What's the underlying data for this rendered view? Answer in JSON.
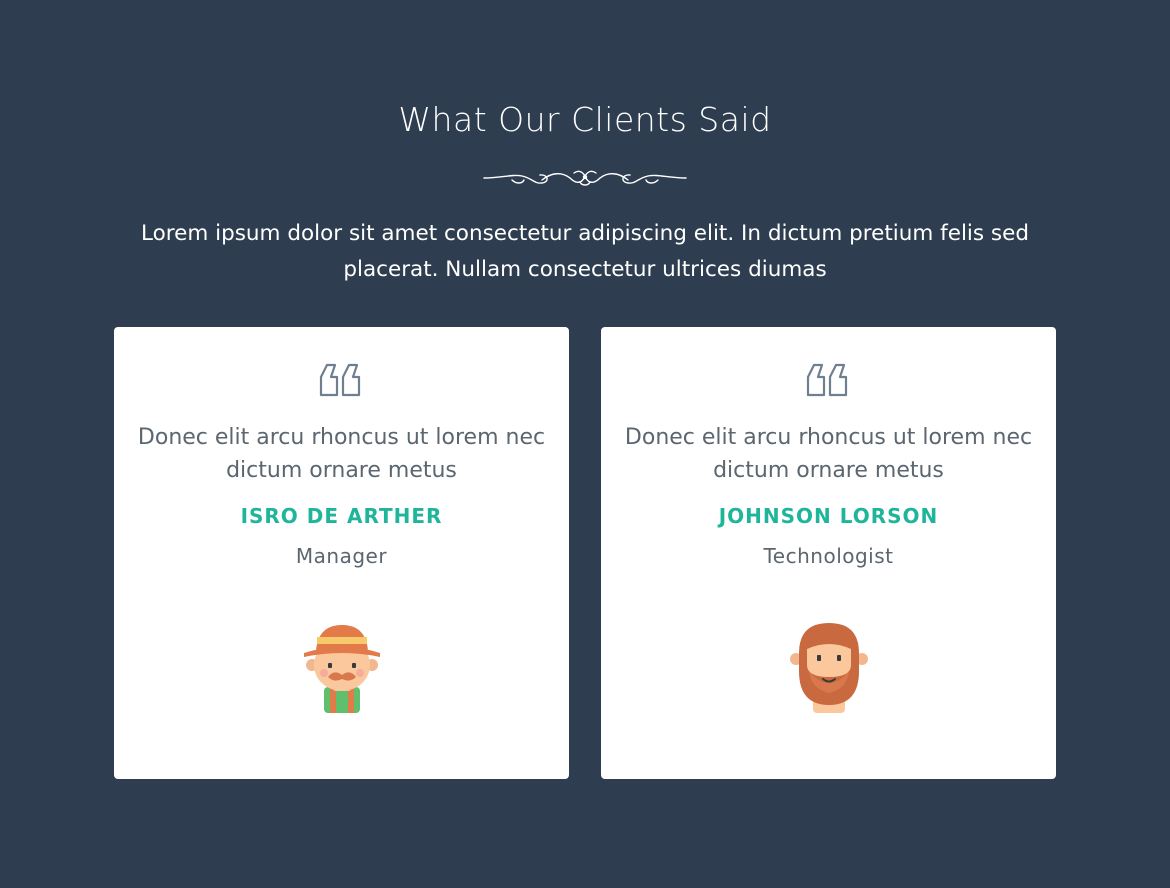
{
  "section": {
    "title": "What Our Clients Said",
    "intro": "Lorem ipsum dolor sit amet consectetur adipiscing elit. In dictum pretium felis sed placerat. Nullam consectetur ultrices diumas"
  },
  "testimonials": [
    {
      "quote": "Donec elit arcu rhoncus ut lorem nec dictum ornare metus",
      "name": "ISRO DE ARTHER",
      "role": "Manager",
      "avatar_icon": "farmer-avatar-icon"
    },
    {
      "quote": "Donec elit arcu rhoncus ut lorem nec dictum ornare metus",
      "name": "JOHNSON LORSON",
      "role": "Technologist",
      "avatar_icon": "bearded-man-avatar-icon"
    }
  ],
  "colors": {
    "background": "#2e3e50",
    "card": "#ffffff",
    "accent": "#1fb59a",
    "body_text": "#5b6670",
    "quote_icon": "#6f7f8f"
  }
}
